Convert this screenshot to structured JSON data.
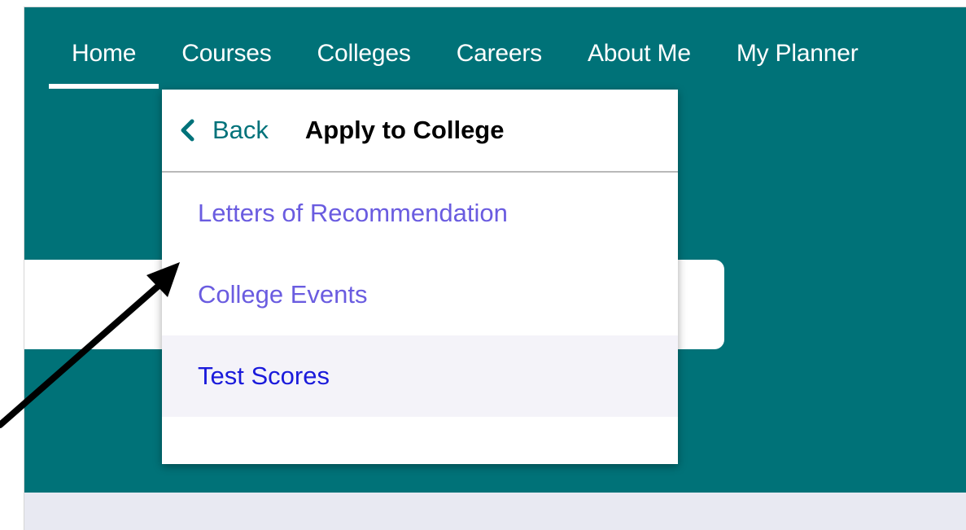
{
  "nav": {
    "items": [
      {
        "label": "Home",
        "active": true
      },
      {
        "label": "Courses",
        "active": false
      },
      {
        "label": "Colleges",
        "active": false
      },
      {
        "label": "Careers",
        "active": false
      },
      {
        "label": "About Me",
        "active": false
      },
      {
        "label": "My Planner",
        "active": false
      }
    ]
  },
  "dropdown": {
    "back_label": "Back",
    "title": "Apply to College",
    "items": [
      {
        "label": "Letters of Recommendation"
      },
      {
        "label": "College Events"
      },
      {
        "label": "Test Scores",
        "highlighted": true
      }
    ]
  },
  "icons": {
    "back": "chevron-left-icon",
    "annotation": "arrow-icon"
  },
  "colors": {
    "header_bg": "#007278",
    "link": "#6a5ce0",
    "link_hover": "#1a1adb",
    "back_text": "#00727a",
    "page_bg": "#e8e9f2"
  }
}
